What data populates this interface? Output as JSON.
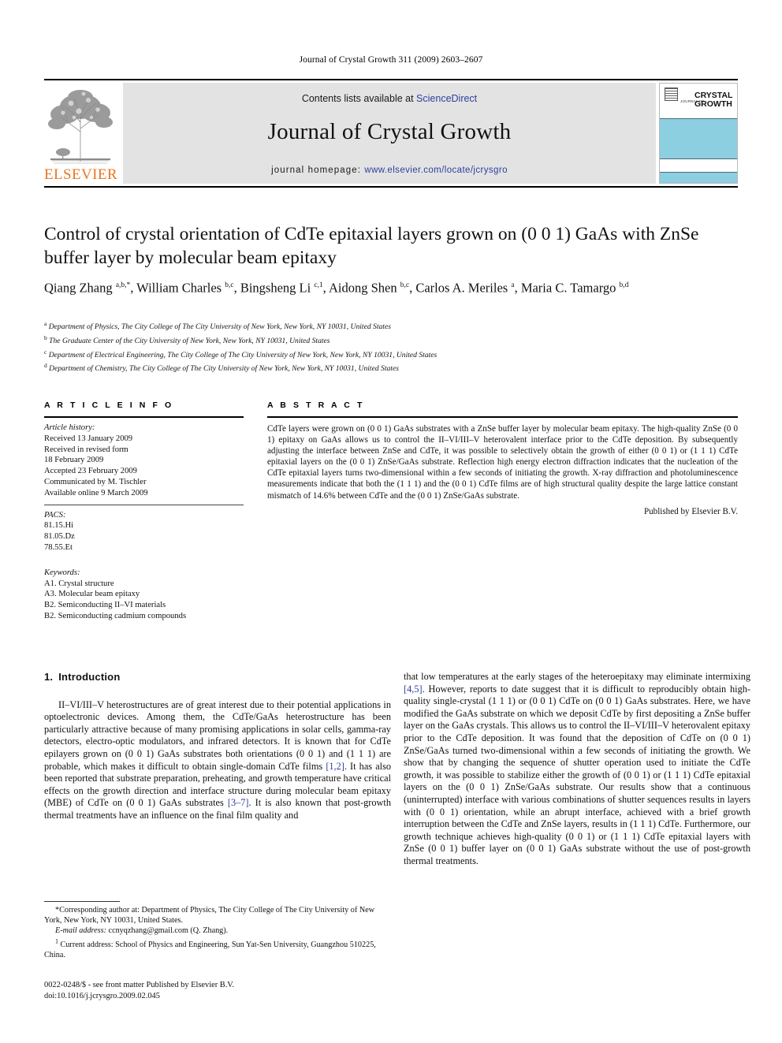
{
  "running_head": "Journal of Crystal Growth 311 (2009) 2603–2607",
  "masthead": {
    "contents_prefix": "Contents lists available at ",
    "contents_link": "ScienceDirect",
    "journal_title": "Journal of Crystal Growth",
    "homepage_prefix": "journal homepage: ",
    "homepage_url": "www.elsevier.com/locate/jcrysgro",
    "publisher_wordmark": "ELSEVIER",
    "cover": {
      "journal_of": "JOURNAL OF",
      "name_line1": "CRYSTAL",
      "name_line2": "GROWTH"
    },
    "colors": {
      "link": "#2b3f9e",
      "elsevier_orange": "#E87722",
      "panel_grey": "#e3e3e3",
      "cover_blue": "#8ccfe0"
    }
  },
  "article": {
    "title": "Control of crystal orientation of CdTe epitaxial layers grown on (0 0 1) GaAs with ZnSe buffer layer by molecular beam epitaxy",
    "authors_html": "Qiang Zhang <sup>a,b,*</sup>, William Charles <sup>b,c</sup>, Bingsheng Li <sup>c,1</sup>, Aidong Shen <sup>b,c</sup>, Carlos A. Meriles <sup>a</sup>, Maria C. Tamargo <sup>b,d</sup>",
    "affiliations": [
      {
        "mark": "a",
        "text": "Department of Physics, The City College of The City University of New York, New York, NY 10031, United States"
      },
      {
        "mark": "b",
        "text": "The Graduate Center of the City University of New York, New York, NY 10031, United States"
      },
      {
        "mark": "c",
        "text": "Department of Electrical Engineering, The City College of The City University of New York, New York, NY 10031, United States"
      },
      {
        "mark": "d",
        "text": "Department of Chemistry, The City College of The City University of New York, New York, NY 10031, United States"
      }
    ]
  },
  "article_info": {
    "heading": "A R T I C L E   I N F O",
    "history_label": "Article history:",
    "history": [
      "Received 13 January 2009",
      "Received in revised form",
      "18 February 2009",
      "Accepted 23 February 2009",
      "Communicated by M. Tischler",
      "Available online 9 March 2009"
    ],
    "pacs_label": "PACS:",
    "pacs": [
      "81.15.Hi",
      "81.05.Dz",
      "78.55.Et"
    ],
    "keywords_label": "Keywords:",
    "keywords": [
      "A1. Crystal structure",
      "A3. Molecular beam epitaxy",
      "B2. Semiconducting II–VI materials",
      "B2. Semiconducting cadmium compounds"
    ]
  },
  "abstract": {
    "heading": "A B S T R A C T",
    "body": "CdTe layers were grown on (0 0 1) GaAs substrates with a ZnSe buffer layer by molecular beam epitaxy. The high-quality ZnSe (0 0 1) epitaxy on GaAs allows us to control the II–VI/III–V heterovalent interface prior to the CdTe deposition. By subsequently adjusting the interface between ZnSe and CdTe, it was possible to selectively obtain the growth of either (0 0 1) or (1 1 1) CdTe epitaxial layers on the (0 0 1) ZnSe/GaAs substrate. Reflection high energy electron diffraction indicates that the nucleation of the CdTe epitaxial layers turns two-dimensional within a few seconds of initiating the growth. X-ray diffraction and photoluminescence measurements indicate that both the (1 1 1) and the (0 0 1) CdTe films are of high structural quality despite the large lattice constant mismatch of 14.6% between CdTe and the (0 0 1) ZnSe/GaAs substrate.",
    "published_by": "Published by Elsevier B.V."
  },
  "body": {
    "section_number": "1.",
    "section_title": "Introduction",
    "left_paragraph_part1": "II–VI/III–V heterostructures are of great interest due to their potential applications in optoelectronic devices. Among them, the CdTe/GaAs heterostructure has been particularly attractive because of many promising applications in solar cells, gamma-ray detectors, electro-optic modulators, and infrared detectors. It is known that for CdTe epilayers grown on (0 0 1) GaAs substrates both orientations (0 0 1) and (1 1 1) are probable, which makes it difficult to obtain single-domain CdTe films ",
    "ref_12": "[1,2]",
    "left_paragraph_part2": ". It has also been reported that substrate preparation, preheating, and growth temperature have critical effects on the growth direction and interface structure during molecular beam epitaxy (MBE) of CdTe on (0 0 1) GaAs substrates ",
    "ref_37": "[3–7]",
    "left_paragraph_part3": ". It is also known that post-growth thermal treatments have an influence on the final film quality and",
    "right_paragraph_part1": "that low temperatures at the early stages of the heteroepitaxy may eliminate intermixing ",
    "ref_45": "[4,5]",
    "right_paragraph_part2": ". However, reports to date suggest that it is difficult to reproducibly obtain high-quality single-crystal (1 1 1) or (0 0 1) CdTe on (0 0 1) GaAs substrates. Here, we have modified the GaAs substrate on which we deposit CdTe by first depositing a ZnSe buffer layer on the GaAs crystals. This allows us to control the II–VI/III–V heterovalent epitaxy prior to the CdTe deposition. It was found that the deposition of CdTe on (0 0 1) ZnSe/GaAs turned two-dimensional within a few seconds of initiating the growth. We show that by changing the sequence of shutter operation used to initiate the CdTe growth, it was possible to stabilize either the growth of (0 0 1) or (1 1 1) CdTe epitaxial layers on the (0 0 1) ZnSe/GaAs substrate. Our results show that a continuous (uninterrupted) interface with various combinations of shutter sequences results in layers with (0 0 1) orientation, while an abrupt interface, achieved with a brief growth interruption between the CdTe and ZnSe layers, results in (1 1 1) CdTe. Furthermore, our growth technique achieves high-quality (0 0 1) or (1 1 1) CdTe epitaxial layers with ZnSe (0 0 1) buffer layer on (0 0 1) GaAs substrate without the use of post-growth thermal treatments."
  },
  "footnotes": {
    "corresponding": "*Corresponding author at: Department of Physics, The City College of The City University of New York, New York, NY 10031, United States.",
    "email_label": "E-mail address:",
    "email": "ccnyqzhang@gmail.com (Q. Zhang).",
    "current_address_mark": "1",
    "current_address": "Current address: School of Physics and Engineering, Sun Yat-Sen University, Guangzhou 510225, China."
  },
  "imprint": {
    "line1": "0022-0248/$ - see front matter Published by Elsevier B.V.",
    "line2": "doi:10.1016/j.jcrysgro.2009.02.045"
  }
}
